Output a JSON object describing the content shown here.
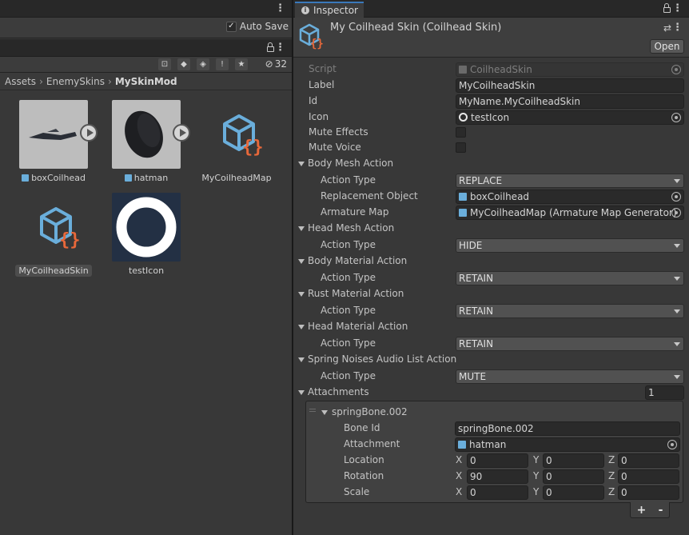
{
  "left": {
    "toolbar": {
      "auto_save_label": "Auto Save",
      "auto_save_checked": true,
      "hidden_count": "32"
    },
    "breadcrumb": [
      "Assets",
      "EnemySkins",
      "MySkinMod"
    ],
    "assets": [
      {
        "name": "boxCoilhead",
        "type": "prefab"
      },
      {
        "name": "hatman",
        "type": "prefab"
      },
      {
        "name": "MyCoilheadMap",
        "type": "scriptable-object"
      },
      {
        "name": "MyCoilheadSkin",
        "type": "scriptable-object",
        "selected": true
      },
      {
        "name": "testIcon",
        "type": "texture"
      }
    ]
  },
  "inspector": {
    "tab_label": "Inspector",
    "title": "My Coilhead Skin (Coilhead Skin)",
    "open_label": "Open",
    "fields": {
      "script": {
        "label": "Script",
        "value": "CoilheadSkin"
      },
      "label": {
        "label": "Label",
        "value": "MyCoilheadSkin"
      },
      "id": {
        "label": "Id",
        "value": "MyName.MyCoilheadSkin"
      },
      "icon": {
        "label": "Icon",
        "value": "testIcon"
      },
      "mute_effects": {
        "label": "Mute Effects"
      },
      "mute_voice": {
        "label": "Mute Voice"
      }
    },
    "body_mesh": {
      "header": "Body Mesh Action",
      "action_type_label": "Action Type",
      "action_type": "REPLACE",
      "replacement_label": "Replacement Object",
      "replacement": "boxCoilhead",
      "armature_label": "Armature Map",
      "armature": "MyCoilheadMap (Armature Map Generator)"
    },
    "head_mesh": {
      "header": "Head Mesh Action",
      "action_type_label": "Action Type",
      "action_type": "HIDE"
    },
    "body_material": {
      "header": "Body Material Action",
      "action_type_label": "Action Type",
      "action_type": "RETAIN"
    },
    "rust_material": {
      "header": "Rust Material Action",
      "action_type_label": "Action Type",
      "action_type": "RETAIN"
    },
    "head_material": {
      "header": "Head Material Action",
      "action_type_label": "Action Type",
      "action_type": "RETAIN"
    },
    "spring_noises": {
      "header": "Spring Noises Audio List Action",
      "action_type_label": "Action Type",
      "action_type": "MUTE"
    },
    "attachments": {
      "header": "Attachments",
      "count": "1",
      "item": {
        "header": "springBone.002",
        "bone_id_label": "Bone Id",
        "bone_id": "springBone.002",
        "attachment_label": "Attachment",
        "attachment": "hatman",
        "location_label": "Location",
        "location": {
          "x": "0",
          "y": "0",
          "z": "0"
        },
        "rotation_label": "Rotation",
        "rotation": {
          "x": "90",
          "y": "0",
          "z": "0"
        },
        "scale_label": "Scale",
        "scale": {
          "x": "0",
          "y": "0",
          "z": "0"
        }
      },
      "axis_labels": {
        "x": "X",
        "y": "Y",
        "z": "Z"
      },
      "add_label": "+",
      "remove_label": "-"
    }
  },
  "colors": {
    "accent": "#3a79bb",
    "cube_blue": "#6aaedb",
    "braces_orange": "#e8683a"
  }
}
